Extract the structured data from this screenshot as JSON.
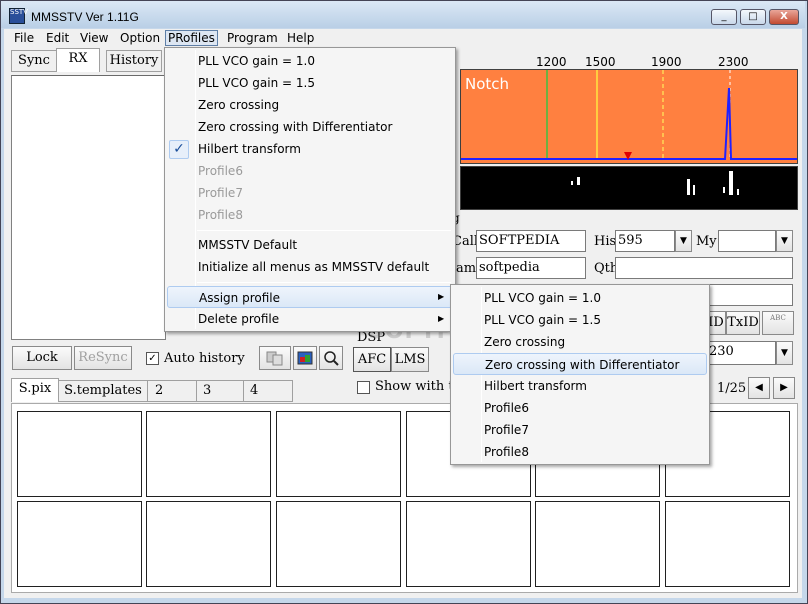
{
  "window": {
    "title": "MMSSTV Ver 1.11G",
    "icon_label": "SSTV",
    "controls": {
      "minimize": "_",
      "maximize": "□",
      "close": "X"
    }
  },
  "menubar": [
    "File",
    "Edit",
    "View",
    "Option",
    "PRofiles",
    "Program",
    "Help"
  ],
  "left_tabs": [
    "Sync",
    "RX",
    "History"
  ],
  "left_buttons": {
    "lock": "Lock",
    "resync": "ReSync",
    "auto_history": "Auto history",
    "auto_history_checked": "✓"
  },
  "scope": {
    "freq_labels": [
      "1200",
      "1500",
      "1900",
      "2300"
    ],
    "notch_label": "Notch",
    "colors": {
      "scope_bg": "#ff8040",
      "waterfall_bg": "#000000",
      "line_1200": "#40c040",
      "line_1500": "#ffff40",
      "peak": "#0000ff",
      "marker": "#ff0000"
    }
  },
  "log": {
    "group_label": "g",
    "call_label": "Call",
    "call_value": "SOFTPEDIA",
    "his_label": "His",
    "his_value": "595",
    "my_label": "My",
    "my_value": "",
    "name_label": "ame",
    "name_value": "softpedia",
    "qth_label": "Qth",
    "qth_value": "",
    "id_label": "ID",
    "txid_label": "TxID",
    "abc_label": "ABC",
    "number_value": "230"
  },
  "dsp": {
    "label": "DSP",
    "afc": "AFC",
    "lms": "LMS",
    "show_with": "Show with te"
  },
  "bottom_tabs": [
    "S.pix",
    "S.templates 1",
    "2",
    "3",
    "4"
  ],
  "page_counter": "1/25",
  "nav": {
    "prev": "◀",
    "next": "▶"
  },
  "profiles_menu": {
    "items": [
      {
        "label": "PLL VCO gain = 1.0",
        "enabled": true
      },
      {
        "label": "PLL VCO gain = 1.5",
        "enabled": true
      },
      {
        "label": "Zero crossing",
        "enabled": true
      },
      {
        "label": "Zero crossing with Differentiator",
        "enabled": true
      },
      {
        "label": "Hilbert transform",
        "enabled": true,
        "checked": true
      },
      {
        "label": "Profile6",
        "enabled": false
      },
      {
        "label": "Profile7",
        "enabled": false
      },
      {
        "label": "Profile8",
        "enabled": false
      }
    ],
    "default_items": [
      "MMSSTV Default",
      "Initialize all menus as MMSSTV default"
    ],
    "submenu_items": [
      "Assign profile",
      "Delete profile"
    ],
    "checkmark": "✓",
    "arrow": "▶"
  },
  "assign_submenu": [
    "PLL VCO gain = 1.0",
    "PLL VCO gain = 1.5",
    "Zero crossing",
    "Zero crossing with Differentiator",
    "Hilbert transform",
    "Profile6",
    "Profile7",
    "Profile8"
  ],
  "watermark": "SOFTPEDIA"
}
